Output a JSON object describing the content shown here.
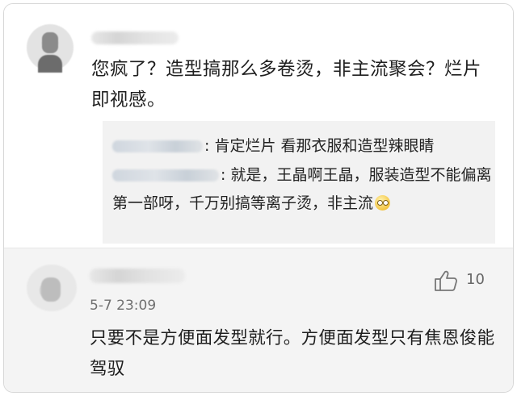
{
  "main_comment": {
    "text": "您疯了？造型搞那么多卷烫，非主流聚会？烂片即视感。",
    "replies": [
      {
        "text": ": 肯定烂片 看那衣服和造型辣眼睛"
      },
      {
        "text": ": 就是，王晶啊王晶，服装造型不能偏离第一部呀，千万别搞等离子烫，非主流"
      }
    ]
  },
  "second_comment": {
    "time": "5-7 23:09",
    "like_count": "10",
    "text": "只要不是方便面发型就行。方便面发型只有焦恩俊能驾驭"
  },
  "icons": {
    "like": "thumbs-up-icon",
    "emoji": "rolling-eyes-emoji-icon"
  },
  "colors": {
    "text": "#1f1f1f",
    "reply_bg": "#f2f2f2",
    "comment2_bg": "#f4f4f4",
    "muted": "#707070"
  }
}
